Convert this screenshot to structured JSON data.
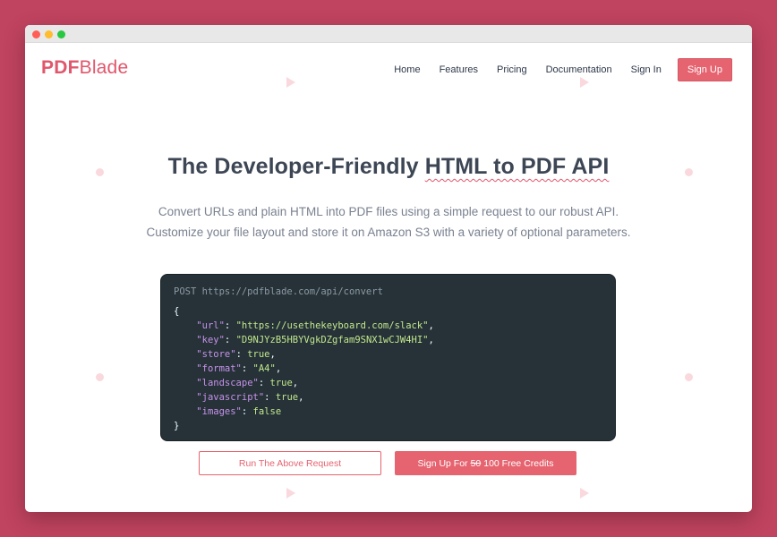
{
  "window": {
    "controls": [
      "close",
      "minimize",
      "maximize"
    ]
  },
  "brand": {
    "logo_bold": "PDF",
    "logo_light": "Blade",
    "accent": "#e56470"
  },
  "nav": {
    "links": [
      "Home",
      "Features",
      "Pricing",
      "Documentation",
      "Sign In"
    ],
    "signup": "Sign Up"
  },
  "hero": {
    "title_prefix": "The Developer-Friendly ",
    "title_highlight": "HTML to PDF API",
    "subtitle_line1": "Convert URLs and plain HTML into PDF files using a simple request to our robust API.",
    "subtitle_line2": "Customize your file layout and store it on Amazon S3 with a variety of optional parameters."
  },
  "code": {
    "endpoint": "POST https://pdfblade.com/api/convert",
    "open": "{",
    "close": "}",
    "params": [
      {
        "key": "\"url\"",
        "value": "\"https://usethekeyboard.com/slack\"",
        "type": "string",
        "comma": ","
      },
      {
        "key": "\"key\"",
        "value": "\"D9NJYzB5HBYVgkDZgfam9SNX1wCJW4HI\"",
        "type": "string",
        "comma": ","
      },
      {
        "key": "\"store\"",
        "value": "true",
        "type": "bool",
        "comma": ","
      },
      {
        "key": "\"format\"",
        "value": "\"A4\"",
        "type": "string",
        "comma": ","
      },
      {
        "key": "\"landscape\"",
        "value": "true",
        "type": "bool",
        "comma": ","
      },
      {
        "key": "\"javascript\"",
        "value": "true",
        "type": "bool",
        "comma": ","
      },
      {
        "key": "\"images\"",
        "value": "false",
        "type": "bool",
        "comma": ""
      }
    ]
  },
  "actions": {
    "run": "Run The Above Request",
    "signup_prefix": "Sign Up For",
    "signup_old": "50",
    "signup_new": "100 Free Credits"
  }
}
